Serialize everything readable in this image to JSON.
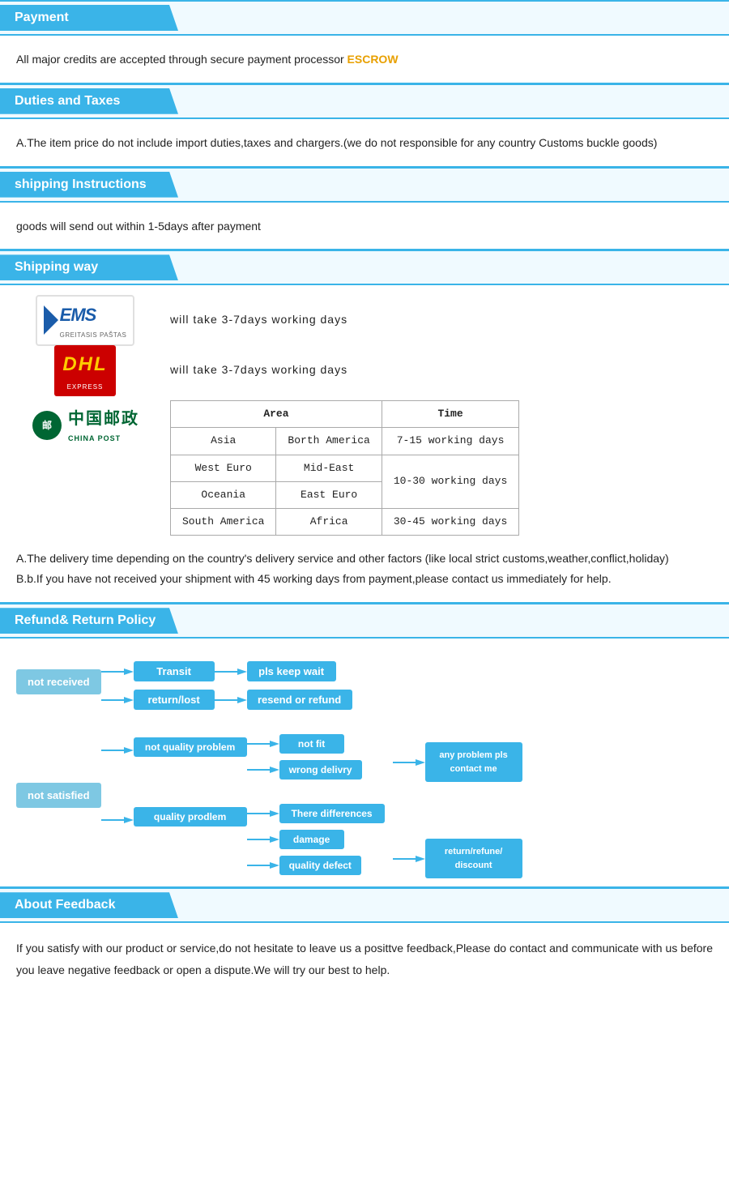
{
  "payment": {
    "header": "Payment",
    "body": "All  major  credits  are  accepted  through  secure  payment  processor",
    "escrow": "ESCROW"
  },
  "duties": {
    "header": "Duties  and  Taxes",
    "body": "A.The  item  price  do  not  include  import  duties,taxes  and  chargers.(we  do  not  responsible  for  any  country  Customs  buckle  goods)"
  },
  "shipping_instructions": {
    "header": "shipping  Instructions",
    "body": "goods  will  send  out  within  1-5days  after  payment"
  },
  "shipping_way": {
    "header": "Shipping  way",
    "ems_text": "will  take  3-7days  working  days",
    "dhl_text": "will  take  3-7days  working  days",
    "table": {
      "col1_header": "Area",
      "col2_header": "Time",
      "rows": [
        {
          "area1": "Asia",
          "area2": "Borth America",
          "time": "7-15 working days"
        },
        {
          "area1": "West Euro",
          "area2": "Mid-East",
          "time": ""
        },
        {
          "area1": "Oceania",
          "area2": "East Euro",
          "time": "10-30 working days"
        },
        {
          "area1": "South America",
          "area2": "Africa",
          "time": "30-45 working days"
        }
      ]
    },
    "note_a": "A.The  delivery  time  depending  on  the  country's  delivery  service  and  other  factors  (like  local  strict  customs,weather,conflict,holiday)",
    "note_b": "B.b.If  you  have  not  received  your  shipment  with  45  working  days  from  payment,please  contact  us  immediately  for  help."
  },
  "refund": {
    "header": "Refund&  Return  Policy",
    "not_received": "not  received",
    "transit": "Transit",
    "return_lost": "return/lost",
    "pls_keep_wait": "pls  keep  wait",
    "resend_or_refund": "resend  or  refund",
    "not_satisfied": "not  satisfied",
    "not_quality_problem": "not  quality  problem",
    "not_fit": "not  fit",
    "wrong_delivry": "wrong  delivry",
    "there_differences": "There  differences",
    "quality_prodlem": "quality  prodlem",
    "damage": "damage",
    "quality_defect": "quality  defect",
    "any_problem": "any  problem  pls\ncontact  me",
    "return_refund_discount": "return/refune/\ndiscount"
  },
  "feedback": {
    "header": "About  Feedback",
    "body": "If  you  satisfy  with  our  product  or  service,do  not  hesitate  to  leave  us  a  posittve  feedback,Please  do  contact  and  communicate  with  us  before  you  leave  negative  feedback  or  open  a  dispute.We  will  try  our  best  to  help."
  }
}
